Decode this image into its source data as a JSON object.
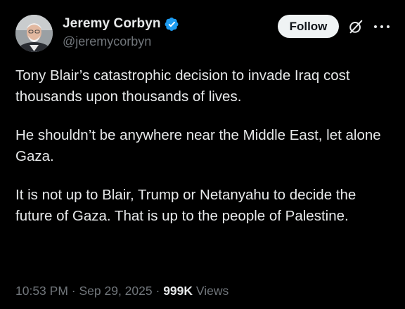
{
  "author": {
    "display_name": "Jeremy Corbyn",
    "handle": "@jeremycorbyn",
    "verified": true,
    "verified_color": "#1d9bf0"
  },
  "actions": {
    "follow_label": "Follow",
    "grok_icon": "grok-icon",
    "more_icon": "more-icon"
  },
  "tweet": {
    "paragraphs": [
      "Tony Blair’s catastrophic decision to invade Iraq cost thousands upon thousands of lives.",
      "He shouldn’t be anywhere near the Middle East, let alone Gaza.",
      "It is not up to Blair, Trump or Netanyahu to decide the future of Gaza. That is up to the people of Palestine."
    ]
  },
  "meta": {
    "time": "10:53 PM",
    "separator": "·",
    "date": "Sep 29, 2025",
    "views_count": "999K",
    "views_label": "Views"
  },
  "colors": {
    "background": "#000000",
    "text_primary": "#e7e9ea",
    "text_secondary": "#71767b",
    "button_bg": "#eff3f4"
  }
}
